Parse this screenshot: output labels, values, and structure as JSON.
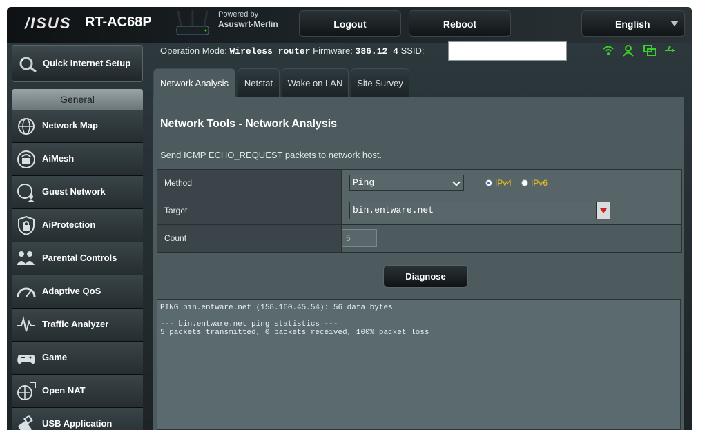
{
  "header": {
    "brand": "/ISUS",
    "model": "RT-AC68P",
    "powered_by": "Powered by",
    "powered_name": "Asuswrt-Merlin",
    "logout_label": "Logout",
    "reboot_label": "Reboot",
    "language": "English"
  },
  "status": {
    "operation_mode_label": "Operation Mode:",
    "operation_mode_value": "Wireless router",
    "firmware_label": "Firmware:",
    "firmware_value": "386.12_4",
    "ssid_label": "SSID:",
    "icons": [
      "wifi-icon",
      "user-icon",
      "network-icon",
      "usb-icon"
    ],
    "icon_color": "#3ccf2b"
  },
  "sidebar": {
    "quick_setup": "Quick Internet Setup",
    "section_title": "General",
    "items": [
      {
        "label": "Network Map",
        "icon": "globe-icon"
      },
      {
        "label": "AiMesh",
        "icon": "mesh-icon"
      },
      {
        "label": "Guest Network",
        "icon": "guest-network-icon"
      },
      {
        "label": "AiProtection",
        "icon": "lock-shield-icon"
      },
      {
        "label": "Parental Controls",
        "icon": "family-icon"
      },
      {
        "label": "Adaptive QoS",
        "icon": "gauge-icon"
      },
      {
        "label": "Traffic Analyzer",
        "icon": "pulse-icon"
      },
      {
        "label": "Game",
        "icon": "gamepad-icon"
      },
      {
        "label": "Open NAT",
        "icon": "open-nat-icon"
      },
      {
        "label": "USB Application",
        "icon": "usb-app-icon"
      }
    ]
  },
  "tabs": [
    {
      "label": "Network Analysis",
      "active": true
    },
    {
      "label": "Netstat",
      "active": false
    },
    {
      "label": "Wake on LAN",
      "active": false
    },
    {
      "label": "Site Survey",
      "active": false
    }
  ],
  "main": {
    "title": "Network Tools - Network Analysis",
    "description": "Send ICMP ECHO_REQUEST packets to network host.",
    "method_label": "Method",
    "method_value": "Ping",
    "ipv4_label": "IPv4",
    "ipv6_label": "IPv6",
    "ip_selected": "IPv4",
    "target_label": "Target",
    "target_value": "bin.entware.net",
    "count_label": "Count",
    "count_value": "5",
    "diagnose_label": "Diagnose",
    "console_output": "PING bin.entware.net (158.160.45.54): 56 data bytes\n\n--- bin.entware.net ping statistics ---\n5 packets transmitted, 0 packets received, 100% packet loss"
  }
}
